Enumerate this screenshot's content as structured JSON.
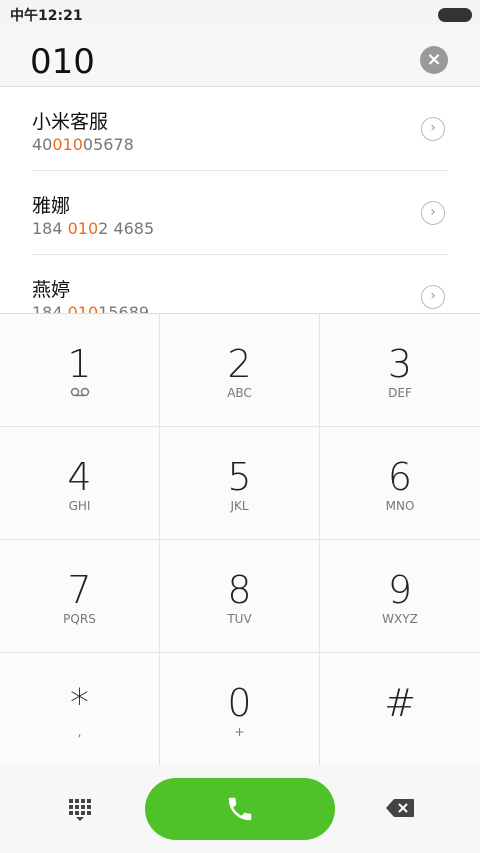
{
  "status": {
    "time": "中午12:21"
  },
  "dial": {
    "input": "010",
    "clear_icon": "×"
  },
  "results": [
    {
      "name": "小米客服",
      "number_parts": [
        "40",
        "010",
        "05678"
      ]
    },
    {
      "name": "雅娜",
      "number_parts": [
        "184 ",
        "010",
        "2 4685"
      ]
    },
    {
      "name": "燕婷",
      "number_parts": [
        "184 ",
        "010",
        "15689"
      ]
    }
  ],
  "keys": [
    {
      "digit": "1",
      "letters": ""
    },
    {
      "digit": "2",
      "letters": "ABC"
    },
    {
      "digit": "3",
      "letters": "DEF"
    },
    {
      "digit": "4",
      "letters": "GHI"
    },
    {
      "digit": "5",
      "letters": "JKL"
    },
    {
      "digit": "6",
      "letters": "MNO"
    },
    {
      "digit": "7",
      "letters": "PQRS"
    },
    {
      "digit": "8",
      "letters": "TUV"
    },
    {
      "digit": "9",
      "letters": "WXYZ"
    },
    {
      "digit": "*",
      "letters": ","
    },
    {
      "digit": "0",
      "letters": "+"
    },
    {
      "digit": "#",
      "letters": ""
    }
  ],
  "colors": {
    "accent": "#f06a1a",
    "call": "#4fc22a"
  },
  "icons": {
    "voicemail": "voicemail-icon",
    "keypad": "keypad-icon",
    "call": "phone-icon",
    "backspace": "backspace-icon"
  }
}
